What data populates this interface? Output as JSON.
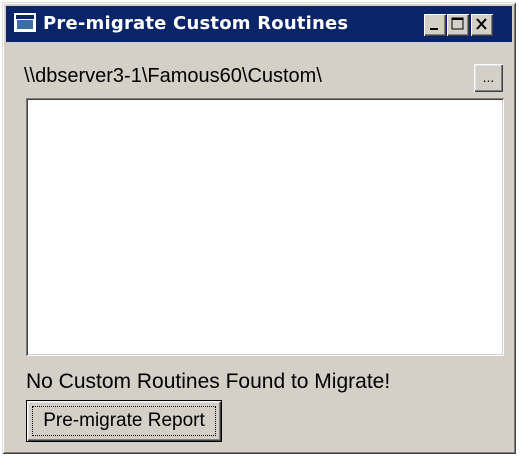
{
  "window": {
    "title": "Pre-migrate Custom Routines",
    "title_bar_color": "#0a246a",
    "face_color": "#d4d0c8",
    "controls": {
      "minimize_icon": "minimize-icon",
      "maximize_icon": "maximize-icon",
      "close_icon": "close-icon"
    }
  },
  "folder": {
    "path": "\\\\dbserver3-1\\Famous60\\Custom\\",
    "browse_label": "..."
  },
  "routines_list": {
    "items": []
  },
  "status": {
    "message": "No Custom Routines Found to Migrate!"
  },
  "actions": {
    "report_label": "Pre-migrate Report"
  }
}
